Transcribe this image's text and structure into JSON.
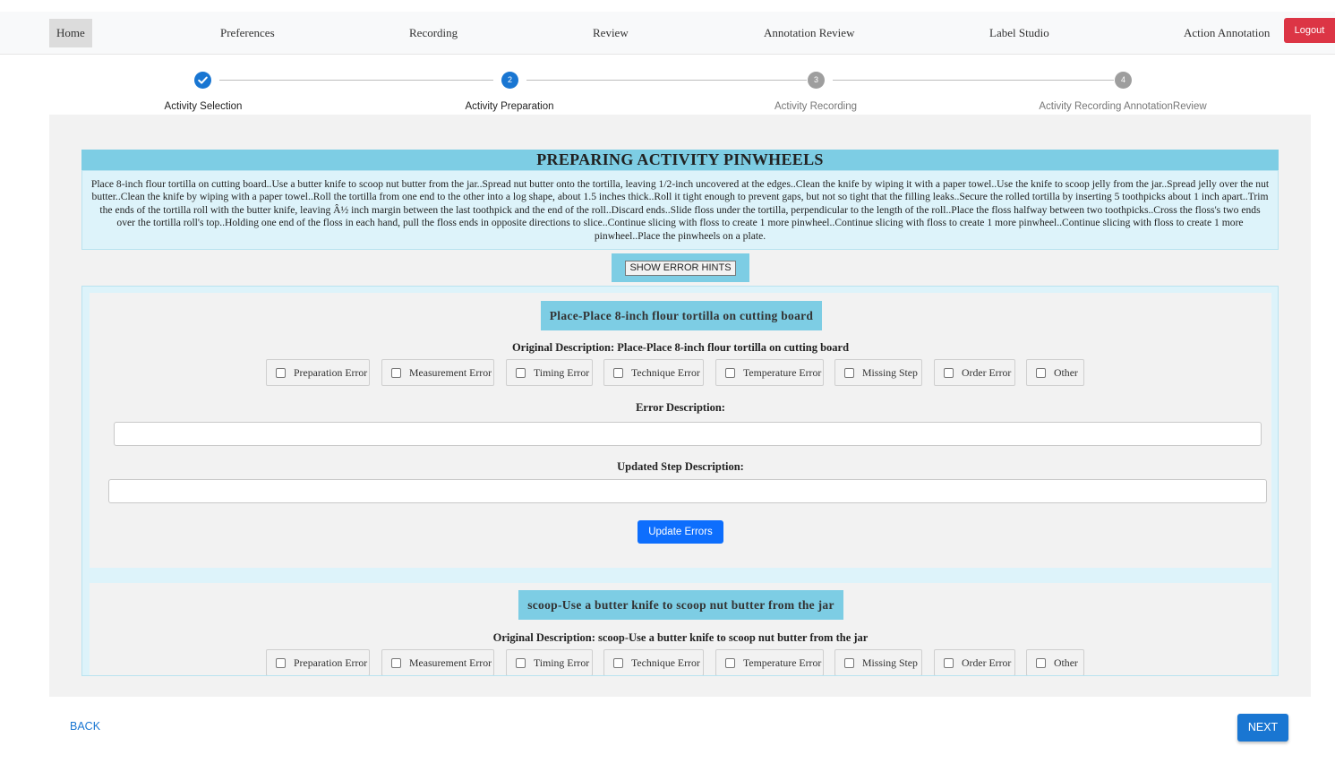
{
  "nav": {
    "home": "Home",
    "preferences": "Preferences",
    "recording": "Recording",
    "review": "Review",
    "annotation_review": "Annotation Review",
    "label_studio": "Label Studio",
    "action_annotation": "Action Annotation",
    "logout": "Logout"
  },
  "stepper": {
    "steps": [
      {
        "label": "Activity Selection",
        "number": "1",
        "state": "done"
      },
      {
        "label": "Activity Preparation",
        "number": "2",
        "state": "current"
      },
      {
        "label": "Activity Recording",
        "number": "3",
        "state": "todo"
      },
      {
        "label": "Activity Recording AnnotationReview",
        "number": "4",
        "state": "todo"
      }
    ],
    "done_icon": "check-icon"
  },
  "main": {
    "title": "PREPARING ACTIVITY PINWHEELS",
    "description": "Place 8-inch flour tortilla on cutting board..Use a butter knife to scoop nut butter from the jar..Spread nut butter onto the tortilla, leaving 1/2-inch uncovered at the edges..Clean the knife by wiping it with a paper towel..Use the knife to scoop jelly from the jar..Spread jelly over the nut butter..Clean the knife by wiping with a paper towel..Roll the tortilla from one end to the other into a log shape, about 1.5 inches thick..Roll it tight enough to prevent gaps, but not so tight that the filling leaks..Secure the rolled tortilla by inserting 5 toothpicks about 1 inch apart..Trim the ends of the tortilla roll with the butter knife, leaving Â½ inch margin between the last toothpick and the end of the roll..Discard ends..Slide floss under the tortilla, perpendicular to the length of the roll..Place the floss halfway between two toothpicks..Cross the floss's two ends over the tortilla roll's top..Holding one end of the floss in each hand, pull the floss ends in opposite directions to slice..Continue slicing with floss to create 1 more pinwheel..Continue slicing with floss to create 1 more pinwheel..Continue slicing with floss to create 1 more pinwheel..Place the pinwheels on a plate.",
    "show_error_hints": "SHOW ERROR HINTS"
  },
  "error_types": [
    "Preparation Error",
    "Measurement Error",
    "Timing Error",
    "Technique Error",
    "Temperature Error",
    "Missing Step",
    "Order Error",
    "Other"
  ],
  "step_cards": [
    {
      "title": "Place-Place 8-inch flour tortilla on cutting board",
      "original_description": "Original Description: Place-Place 8-inch flour tortilla on cutting board",
      "error_description_label": "Error Description:",
      "error_description_value": "",
      "updated_step_label": "Updated Step Description:",
      "updated_step_value": "",
      "update_button": "Update Errors"
    },
    {
      "title": "scoop-Use a butter knife to scoop nut butter from the jar",
      "original_description": "Original Description: scoop-Use a butter knife to scoop nut butter from the jar"
    }
  ],
  "footer": {
    "back": "BACK",
    "next": "NEXT"
  },
  "colors": {
    "primary": "#1976d2",
    "logout": "#dc3545",
    "header_band": "#7dcde4",
    "light_band": "#ddf3fa",
    "update_button": "#0d6efd"
  }
}
